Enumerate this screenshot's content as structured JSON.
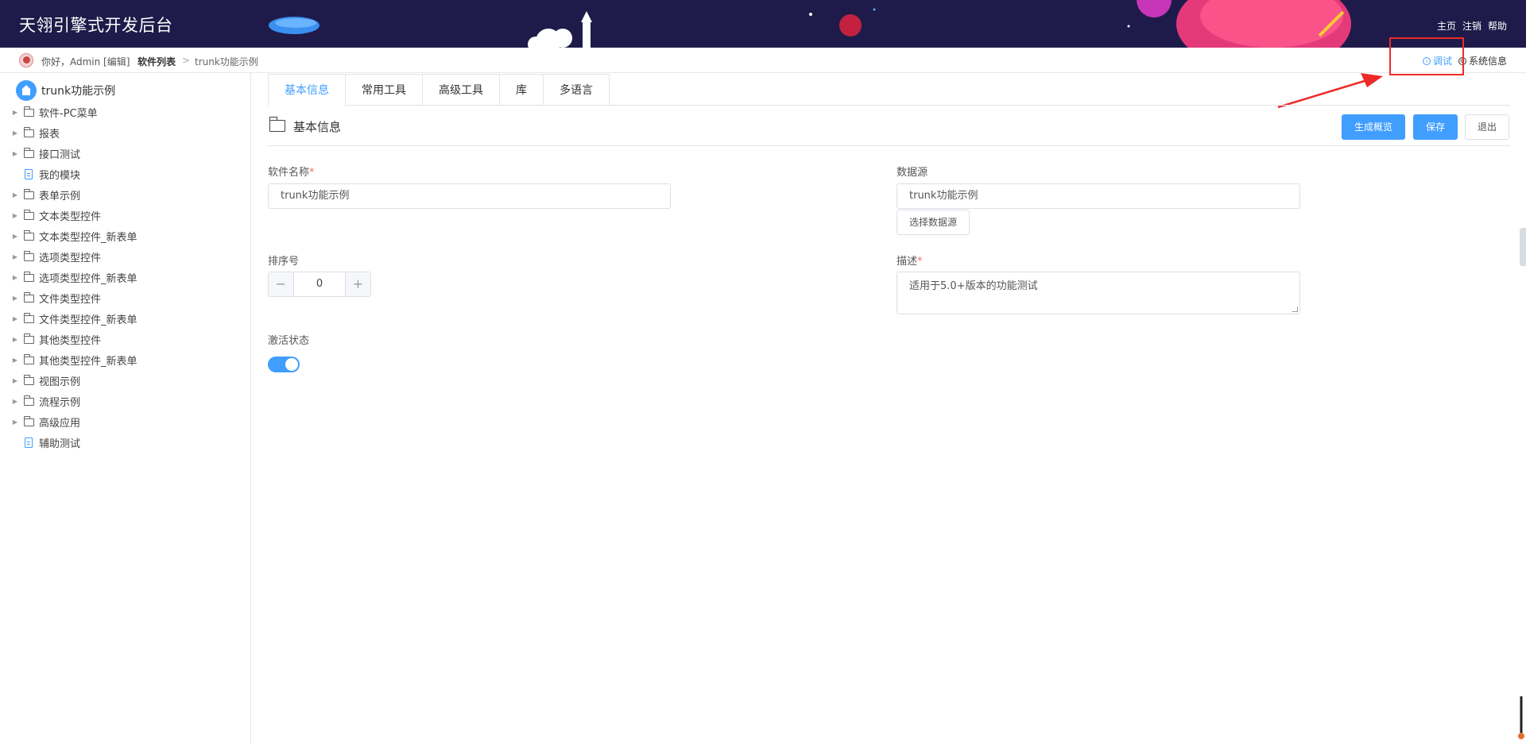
{
  "header": {
    "app_title": "天翎引擎式开发后台",
    "links": [
      "主页",
      "注销",
      "帮助"
    ],
    "bg_color": "#1e1b4a"
  },
  "breadcrumb": {
    "greeting": "你好，Admin [编辑]",
    "items": [
      "软件列表",
      "trunk功能示例"
    ],
    "separator": ">",
    "tools": {
      "debug": "调试",
      "system_info": "系统信息"
    }
  },
  "sidebar": {
    "root_label": "trunk功能示例",
    "items": [
      {
        "label": "软件-PC菜单",
        "type": "folder"
      },
      {
        "label": "报表",
        "type": "folder"
      },
      {
        "label": "接口测试",
        "type": "folder"
      },
      {
        "label": "我的模块",
        "type": "doc"
      },
      {
        "label": "表单示例",
        "type": "folder"
      },
      {
        "label": "文本类型控件",
        "type": "folder"
      },
      {
        "label": "文本类型控件_新表单",
        "type": "folder"
      },
      {
        "label": "选项类型控件",
        "type": "folder"
      },
      {
        "label": "选项类型控件_新表单",
        "type": "folder"
      },
      {
        "label": "文件类型控件",
        "type": "folder"
      },
      {
        "label": "文件类型控件_新表单",
        "type": "folder"
      },
      {
        "label": "其他类型控件",
        "type": "folder"
      },
      {
        "label": "其他类型控件_新表单",
        "type": "folder"
      },
      {
        "label": "视图示例",
        "type": "folder"
      },
      {
        "label": "流程示例",
        "type": "folder"
      },
      {
        "label": "高级应用",
        "type": "folder"
      },
      {
        "label": "辅助测试",
        "type": "doc"
      }
    ]
  },
  "main": {
    "tabs": [
      "基本信息",
      "常用工具",
      "高级工具",
      "库",
      "多语言"
    ],
    "section_title": "基本信息",
    "buttons": {
      "generate": "生成概览",
      "save": "保存",
      "exit": "退出"
    },
    "form": {
      "software_name_label": "软件名称",
      "software_name_value": "trunk功能示例",
      "datasource_label": "数据源",
      "datasource_value": "trunk功能示例",
      "select_datasource": "选择数据源",
      "order_label": "排序号",
      "order_value": "0",
      "description_label": "描述",
      "description_value": "适用于5.0+版本的功能测试",
      "active_label": "激活状态",
      "active_on": true,
      "required_mark": "*"
    }
  },
  "colors": {
    "accent": "#409eff",
    "highlight": "#ef2a2a"
  }
}
